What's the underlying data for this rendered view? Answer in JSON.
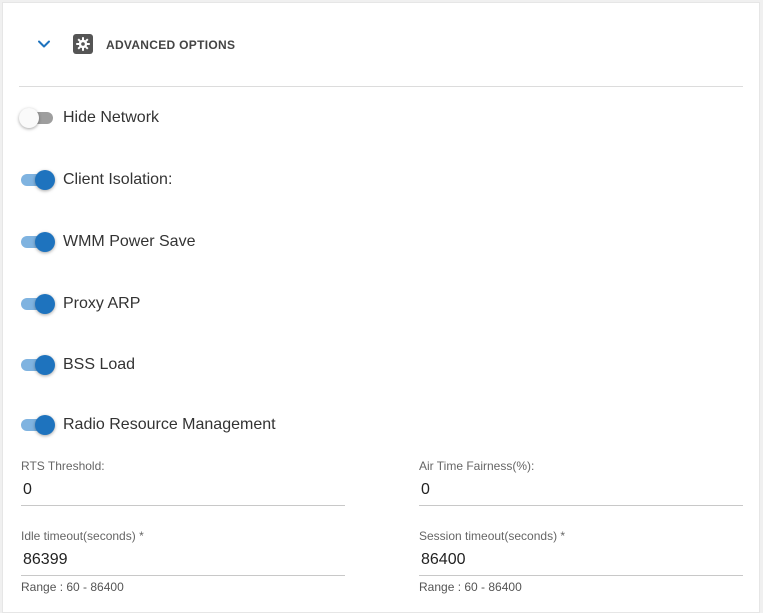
{
  "section": {
    "title": "ADVANCED OPTIONS",
    "expand_icon": "chevron-down-icon",
    "settings_icon": "gear-icon",
    "accent_color": "#1e73be"
  },
  "toggles": [
    {
      "label": "Hide Network",
      "on": false
    },
    {
      "label": "Client Isolation:",
      "on": true
    },
    {
      "label": "WMM Power Save",
      "on": true
    },
    {
      "label": "Proxy ARP",
      "on": true
    },
    {
      "label": "BSS Load",
      "on": true
    },
    {
      "label": "Radio Resource Management",
      "on": true
    }
  ],
  "fields": {
    "rts_threshold": {
      "label": "RTS Threshold:",
      "value": "0"
    },
    "air_time_fairness": {
      "label": "Air Time Fairness(%):",
      "value": "0"
    },
    "idle_timeout": {
      "label": "Idle timeout(seconds)",
      "required": "*",
      "value": "86399",
      "hint": "Range : 60 - 86400"
    },
    "session_timeout": {
      "label": "Session timeout(seconds)",
      "required": "*",
      "value": "86400",
      "hint": "Range : 60 - 86400"
    }
  }
}
